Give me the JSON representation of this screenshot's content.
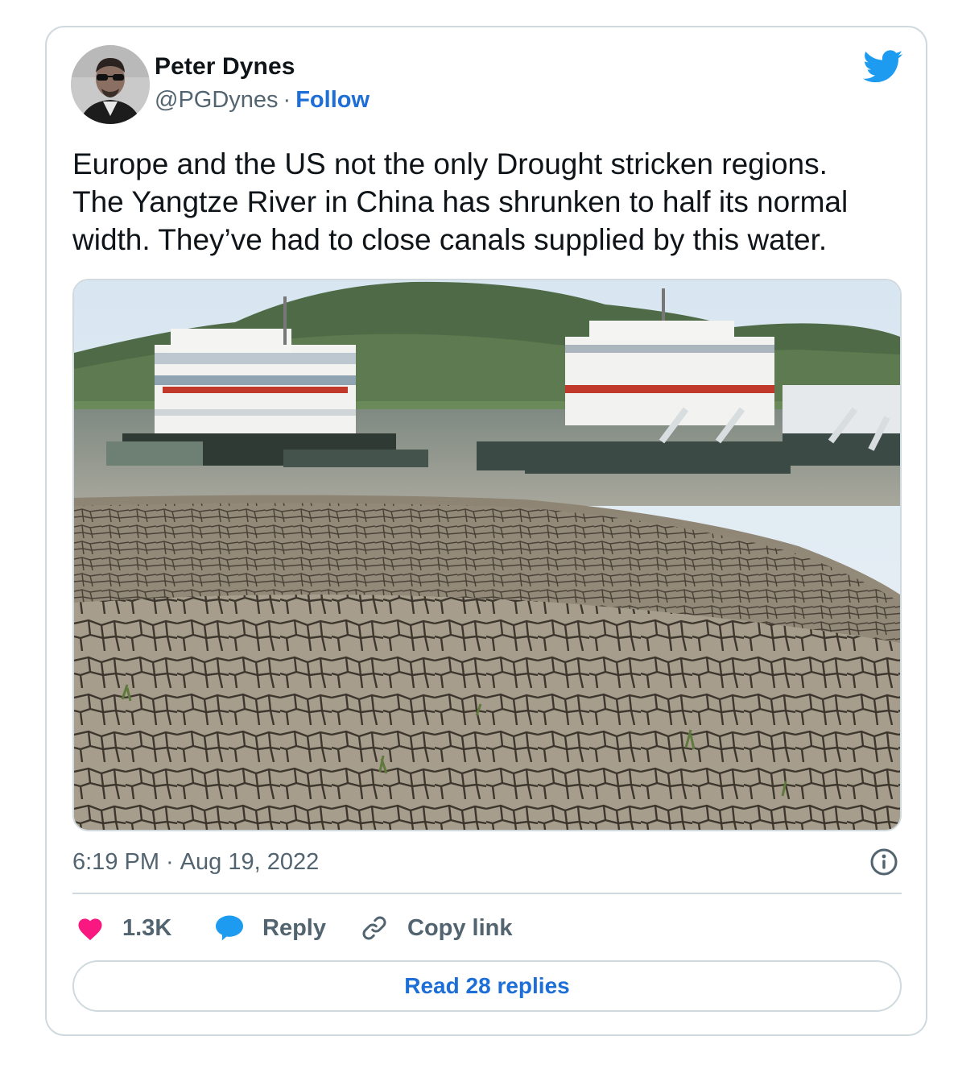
{
  "author": {
    "name": "Peter Dynes",
    "handle": "@PGDynes",
    "separator": "·",
    "follow_label": "Follow"
  },
  "tweet": {
    "lines": [
      "Europe and the US not the only Drought stricken regions.",
      "The Yangtze River in China has shrunken to half its normal",
      "width. They’ve had to close canals supplied by this water."
    ]
  },
  "media": {
    "description_icon": "photo"
  },
  "meta": {
    "time": "6:19 PM",
    "separator": "·",
    "date": "Aug 19, 2022"
  },
  "actions": {
    "like_count": "1.3K",
    "reply_label": "Reply",
    "copy_link_label": "Copy link",
    "read_replies_label": "Read 28 replies"
  },
  "colors": {
    "accent": "#1d6ed6",
    "twitter_blue": "#1d9bf0",
    "like_pink": "#f91880",
    "border": "#cfd9de",
    "muted_text": "#536471"
  },
  "icons": {
    "brand": "twitter-bird-icon",
    "info": "info-icon",
    "like": "heart-icon",
    "reply": "speech-bubble-icon",
    "copy": "link-icon"
  }
}
